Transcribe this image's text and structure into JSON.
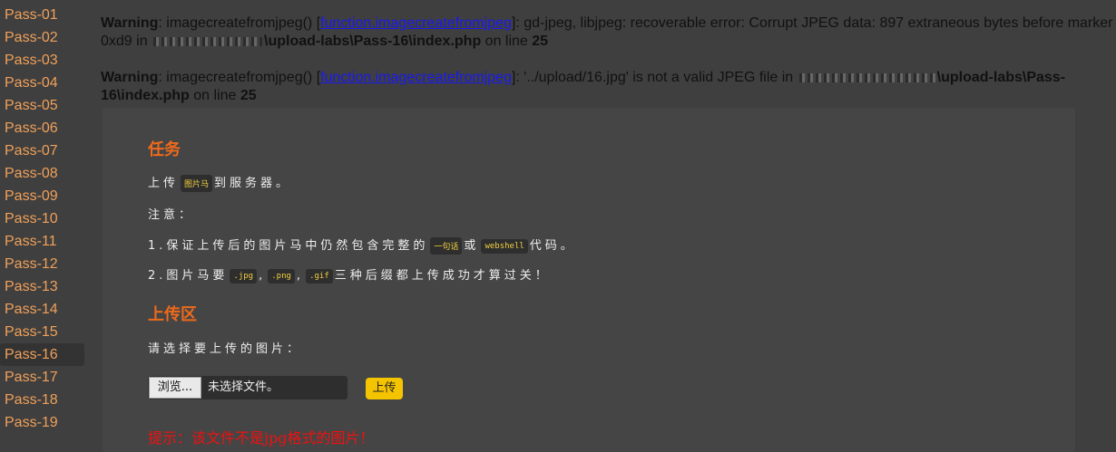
{
  "sidebar": {
    "items": [
      {
        "label": "Pass-01"
      },
      {
        "label": "Pass-02"
      },
      {
        "label": "Pass-03"
      },
      {
        "label": "Pass-04"
      },
      {
        "label": "Pass-05"
      },
      {
        "label": "Pass-06"
      },
      {
        "label": "Pass-07"
      },
      {
        "label": "Pass-08"
      },
      {
        "label": "Pass-09"
      },
      {
        "label": "Pass-10"
      },
      {
        "label": "Pass-11"
      },
      {
        "label": "Pass-12"
      },
      {
        "label": "Pass-13"
      },
      {
        "label": "Pass-14"
      },
      {
        "label": "Pass-15"
      },
      {
        "label": "Pass-16"
      },
      {
        "label": "Pass-17"
      },
      {
        "label": "Pass-18"
      },
      {
        "label": "Pass-19"
      }
    ],
    "active": "Pass-16"
  },
  "warnings": [
    {
      "prefix": "Warning",
      "text1": ": imagecreatefromjpeg() [",
      "link": "function.imagecreatefromjpeg",
      "text2": "]: gd-jpeg, libjpeg: recoverable error: Corrupt JPEG data: 897 extraneous bytes before marker 0xd9 in ",
      "path": "\\upload-labs\\Pass-16\\index.php",
      "text3": " on line ",
      "line": "25"
    },
    {
      "prefix": "Warning",
      "text1": ": imagecreatefromjpeg() [",
      "link": "function.imagecreatefromjpeg",
      "text2": "]: '../upload/16.jpg' is not a valid JPEG file in ",
      "path": "\\upload-labs\\Pass-16\\index.php",
      "text3": " on line ",
      "line": "25"
    }
  ],
  "task": {
    "title": "任务",
    "line1_a": "上传",
    "line1_code": "图片马",
    "line1_b": "到服务器。",
    "note": "注意：",
    "line2_a": "1.保证上传后的图片马中仍然包含完整的",
    "line2_code1": "一句话",
    "line2_mid": "或",
    "line2_code2": "webshell",
    "line2_b": "代码。",
    "line3_a": "2.图片马要",
    "line3_code1": ".jpg",
    "line3_sep1": ",",
    "line3_code2": ".png",
    "line3_sep2": ",",
    "line3_code3": ".gif",
    "line3_b": "三种后缀都上传成功才算过关！"
  },
  "upload": {
    "title": "上传区",
    "prompt": "请选择要上传的图片：",
    "browse_label": "浏览...",
    "file_status": "未选择文件。",
    "submit_label": "上传",
    "message": "提示：该文件不是jpg格式的图片！"
  }
}
